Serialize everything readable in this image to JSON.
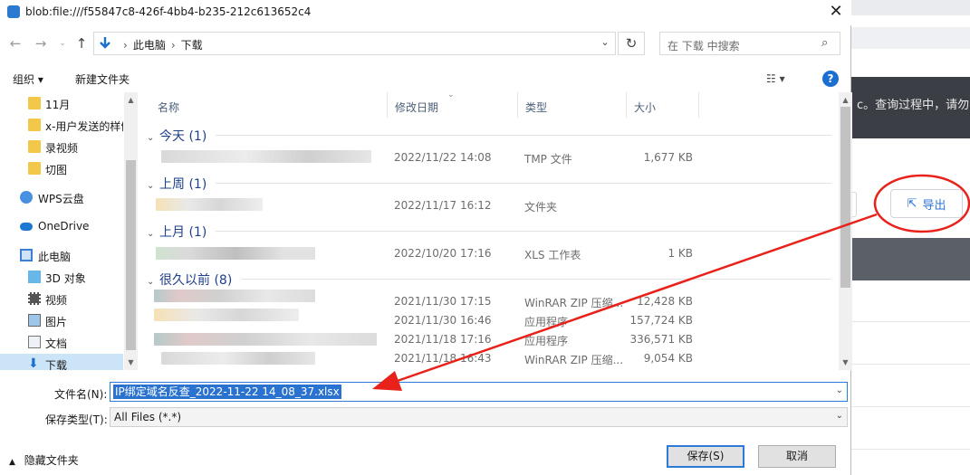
{
  "window": {
    "title": "blob:file:///f55847c8-426f-4bb4-b235-212c613652c4"
  },
  "address": {
    "crumbs": [
      "此电脑",
      "下载"
    ]
  },
  "search": {
    "placeholder": "在 下载 中搜索"
  },
  "toolbar": {
    "organize": "组织 ▾",
    "new_folder": "新建文件夹"
  },
  "nav_pane": {
    "items": [
      {
        "label": "11月",
        "icon": "folder-icon"
      },
      {
        "label": "x-用户发送的样例",
        "icon": "folder-icon"
      },
      {
        "label": "录视频",
        "icon": "folder-icon"
      },
      {
        "label": "切图",
        "icon": "folder-icon"
      },
      {
        "label": "WPS云盘",
        "icon": "cloud-icon"
      },
      {
        "label": "OneDrive",
        "icon": "onedrive-icon"
      },
      {
        "label": "此电脑",
        "icon": "computer-icon"
      },
      {
        "label": "3D 对象",
        "icon": "3d-objects-icon"
      },
      {
        "label": "视频",
        "icon": "video-icon"
      },
      {
        "label": "图片",
        "icon": "pictures-icon"
      },
      {
        "label": "文档",
        "icon": "documents-icon"
      },
      {
        "label": "下载",
        "icon": "download-icon"
      }
    ]
  },
  "columns": {
    "name": "名称",
    "modified": "修改日期",
    "type": "类型",
    "size": "大小"
  },
  "groups": {
    "today": "今天 (1)",
    "last_week": "上周 (1)",
    "last_month": "上月 (1)",
    "long_ago": "很久以前 (8)"
  },
  "files": [
    {
      "date": "2022/11/22 14:08",
      "type": "TMP 文件",
      "size": "1,677 KB"
    },
    {
      "date": "2022/11/17 16:12",
      "type": "文件夹",
      "size": ""
    },
    {
      "date": "2022/10/20 17:16",
      "type": "XLS 工作表",
      "size": "1 KB"
    },
    {
      "date": "2021/11/30 17:15",
      "type": "WinRAR ZIP 压缩...",
      "size": "12,428 KB"
    },
    {
      "date": "2021/11/30 16:46",
      "type": "应用程序",
      "size": "157,724 KB"
    },
    {
      "date": "2021/11/18 17:16",
      "type": "应用程序",
      "size": "336,571 KB"
    },
    {
      "date": "2021/11/18 16:43",
      "type": "WinRAR ZIP 压缩...",
      "size": "9,054 KB"
    }
  ],
  "bottom": {
    "filename_label": "文件名(N):",
    "filename_value": "IP绑定域名反查_2022-11-22 14_08_37.xlsx",
    "filetype_label": "保存类型(T):",
    "filetype_value": "All Files (*.*)",
    "hide_folders": "隐藏文件夹",
    "save": "保存(S)",
    "cancel": "取消"
  },
  "background_page": {
    "banner_text": "c。查询过程中，请勿",
    "export_label": "导出"
  },
  "colors": {
    "accent": "#2c7bd6",
    "annotation": "#e8221b"
  }
}
